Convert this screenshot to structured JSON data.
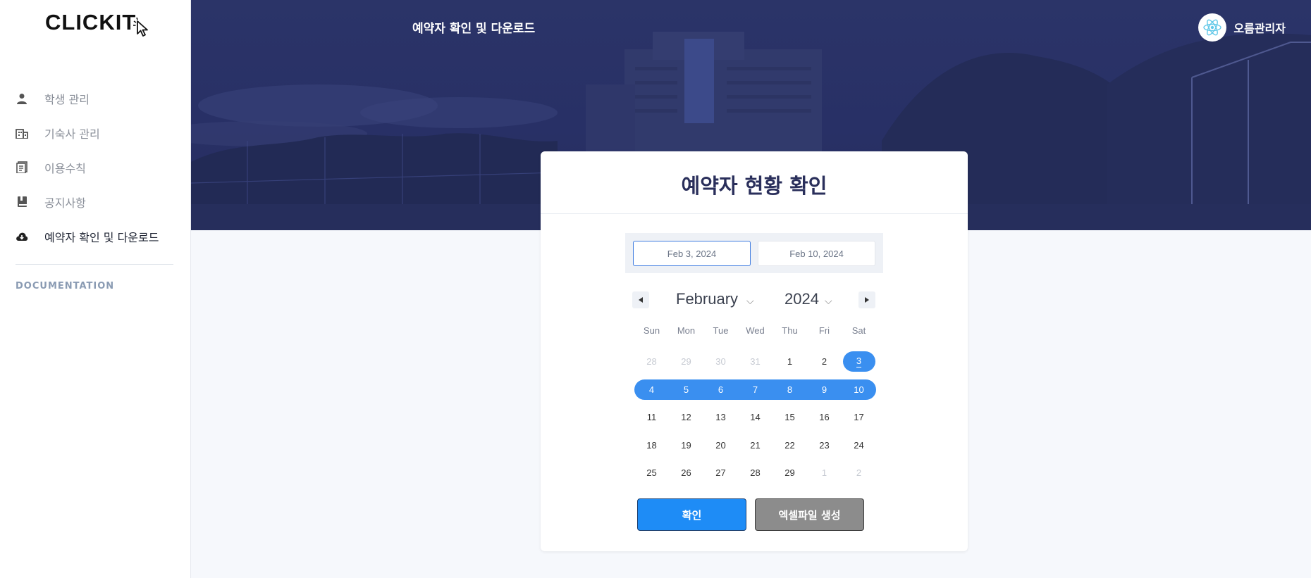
{
  "app": {
    "logo_text": "CLICKIT"
  },
  "sidebar": {
    "items": [
      {
        "label": "학생 관리",
        "icon": "person-icon"
      },
      {
        "label": "기숙사 관리",
        "icon": "building-icon"
      },
      {
        "label": "이용수칙",
        "icon": "document-icon"
      },
      {
        "label": "공지사항",
        "icon": "book-icon"
      },
      {
        "label": "예약자 확인 및 다운로드",
        "icon": "cloud-download-icon",
        "active": true
      }
    ],
    "section_heading": "DOCUMENTATION"
  },
  "header": {
    "page_title": "예약자 확인 및 다운로드",
    "user_name": "오름관리자",
    "avatar_icon": "react-atom-icon"
  },
  "card": {
    "title": "예약자 현황 확인",
    "start_date": "Feb 3, 2024",
    "end_date": "Feb 10, 2024",
    "calendar": {
      "month": "February",
      "year": "2024",
      "weekdays": [
        "Sun",
        "Mon",
        "Tue",
        "Wed",
        "Thu",
        "Fri",
        "Sat"
      ],
      "weeks": [
        [
          "28",
          "29",
          "30",
          "31",
          "1",
          "2",
          "3"
        ],
        [
          "4",
          "5",
          "6",
          "7",
          "8",
          "9",
          "10"
        ],
        [
          "11",
          "12",
          "13",
          "14",
          "15",
          "16",
          "17"
        ],
        [
          "18",
          "19",
          "20",
          "21",
          "22",
          "23",
          "24"
        ],
        [
          "25",
          "26",
          "27",
          "28",
          "29",
          "1",
          "2"
        ]
      ]
    },
    "confirm_label": "확인",
    "excel_label": "엑셀파일 생성"
  },
  "colors": {
    "accent": "#3a8ff0",
    "confirm_button": "#1e8cf6",
    "excel_button": "#8c8c8c",
    "banner": "#283066",
    "title_text": "#2a2f5b"
  }
}
